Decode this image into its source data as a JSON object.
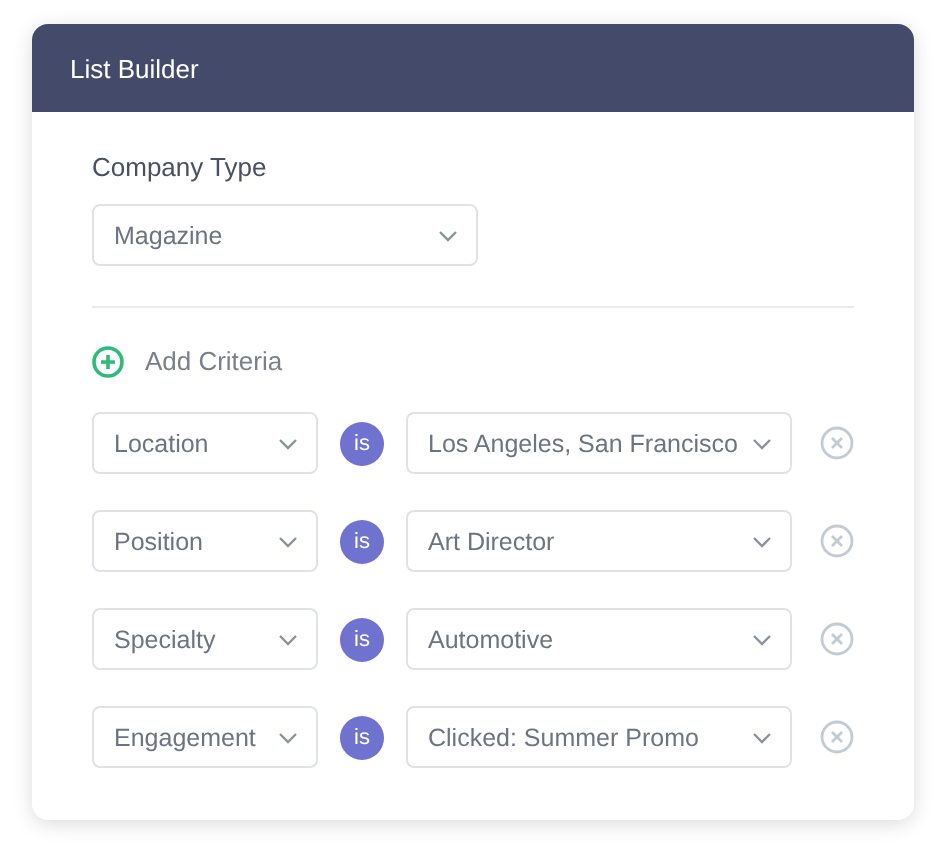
{
  "header": {
    "title": "List Builder"
  },
  "company_type": {
    "label": "Company Type",
    "value": "Magazine"
  },
  "add_criteria": {
    "label": "Add Criteria"
  },
  "criteria": [
    {
      "field": "Location",
      "operator": "is",
      "value": "Los Angeles, San Francisco"
    },
    {
      "field": "Position",
      "operator": "is",
      "value": "Art Director"
    },
    {
      "field": "Specialty",
      "operator": "is",
      "value": "Automotive"
    },
    {
      "field": "Engagement",
      "operator": "is",
      "value": "Clicked: Summer Promo"
    }
  ]
}
